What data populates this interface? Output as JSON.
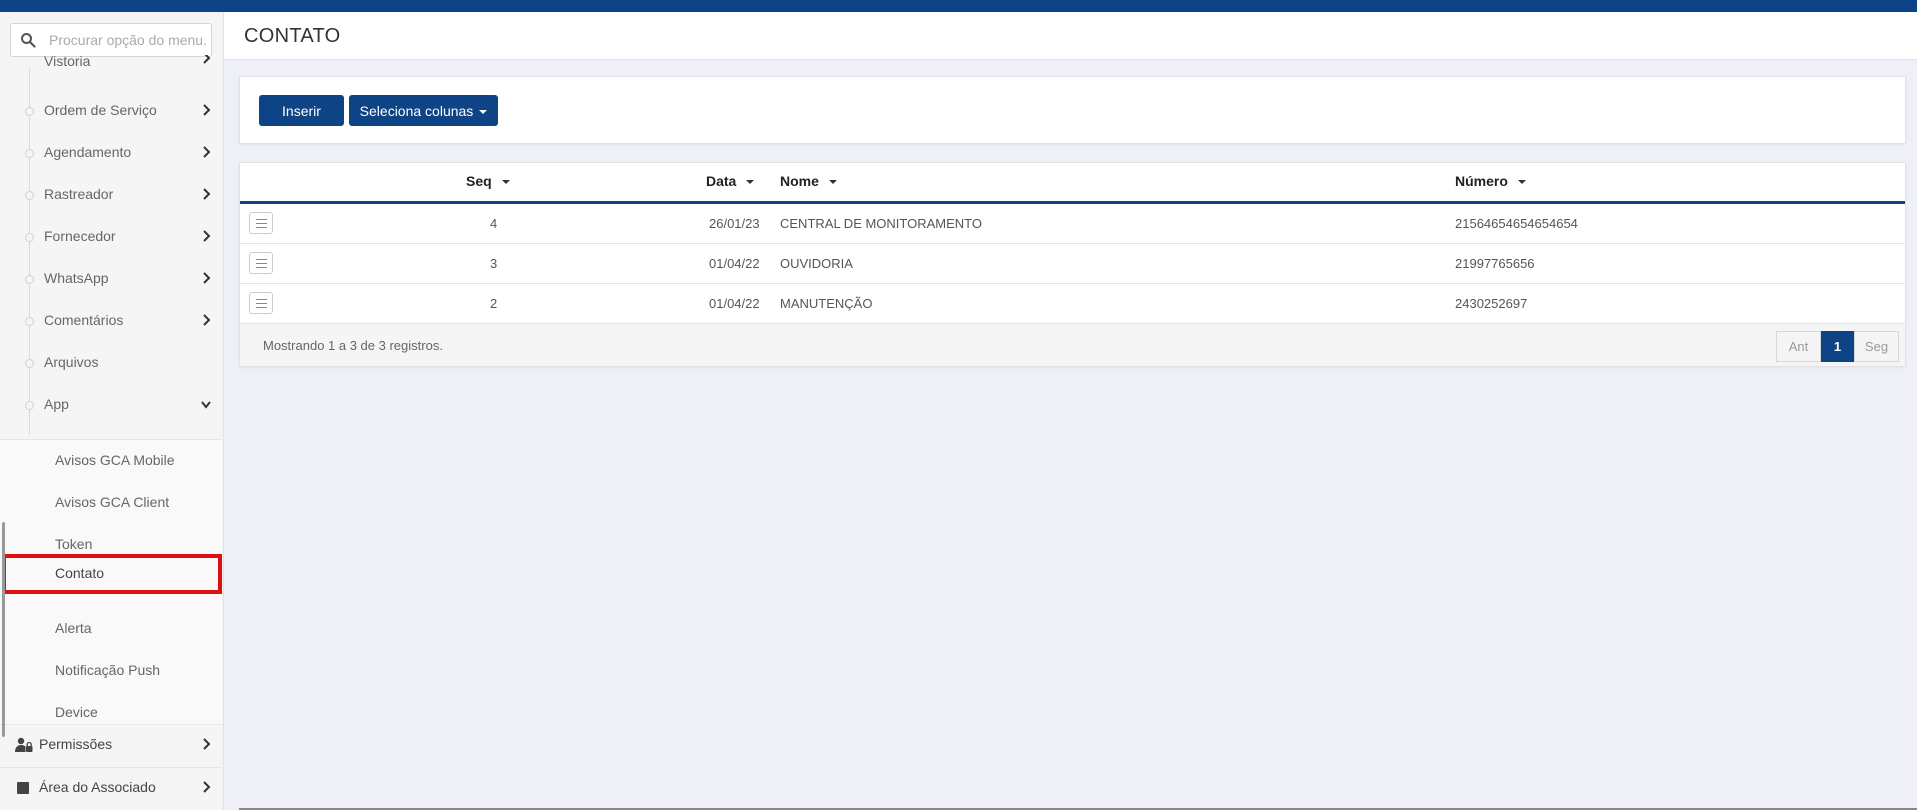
{
  "search": {
    "placeholder": "Procurar opção do menu..."
  },
  "sidebar": {
    "partial_item": "Vistoria",
    "items": [
      {
        "label": "Ordem de Serviço",
        "has_arrow": true
      },
      {
        "label": "Agendamento",
        "has_arrow": true
      },
      {
        "label": "Rastreador",
        "has_arrow": true
      },
      {
        "label": "Fornecedor",
        "has_arrow": true
      },
      {
        "label": "WhatsApp",
        "has_arrow": true
      },
      {
        "label": "Comentários",
        "has_arrow": true
      },
      {
        "label": "Arquivos",
        "has_arrow": false
      },
      {
        "label": "App",
        "has_arrow": true,
        "expanded": true
      }
    ],
    "app_submenu": [
      {
        "label": "Avisos GCA Mobile"
      },
      {
        "label": "Avisos GCA Client"
      },
      {
        "label": "Token"
      },
      {
        "label": "Contato",
        "active": true
      },
      {
        "label": "Alerta"
      },
      {
        "label": "Notificação Push"
      },
      {
        "label": "Device"
      }
    ],
    "sections": [
      {
        "label": "Permissões",
        "icon": "user-lock-icon"
      },
      {
        "label": "Área do Associado",
        "icon": "square-icon"
      }
    ]
  },
  "header": {
    "title": "CONTATO"
  },
  "toolbar": {
    "insert_label": "Inserir",
    "columns_label": "Seleciona colunas"
  },
  "table": {
    "columns": [
      "Seq",
      "Data",
      "Nome",
      "Número"
    ],
    "rows": [
      {
        "seq": "4",
        "data": "26/01/23",
        "nome": "CENTRAL DE MONITORAMENTO",
        "numero": "21564654654654654"
      },
      {
        "seq": "3",
        "data": "01/04/22",
        "nome": "OUVIDORIA",
        "numero": "21997765656"
      },
      {
        "seq": "2",
        "data": "01/04/22",
        "nome": "MANUTENÇÃO",
        "numero": "2430252697"
      }
    ],
    "footer": "Mostrando 1 a 3 de 3 registros."
  },
  "pagination": {
    "prev": "Ant",
    "current": "1",
    "next": "Seg"
  },
  "colors": {
    "primary": "#0e4386",
    "highlight": "#e01010"
  }
}
